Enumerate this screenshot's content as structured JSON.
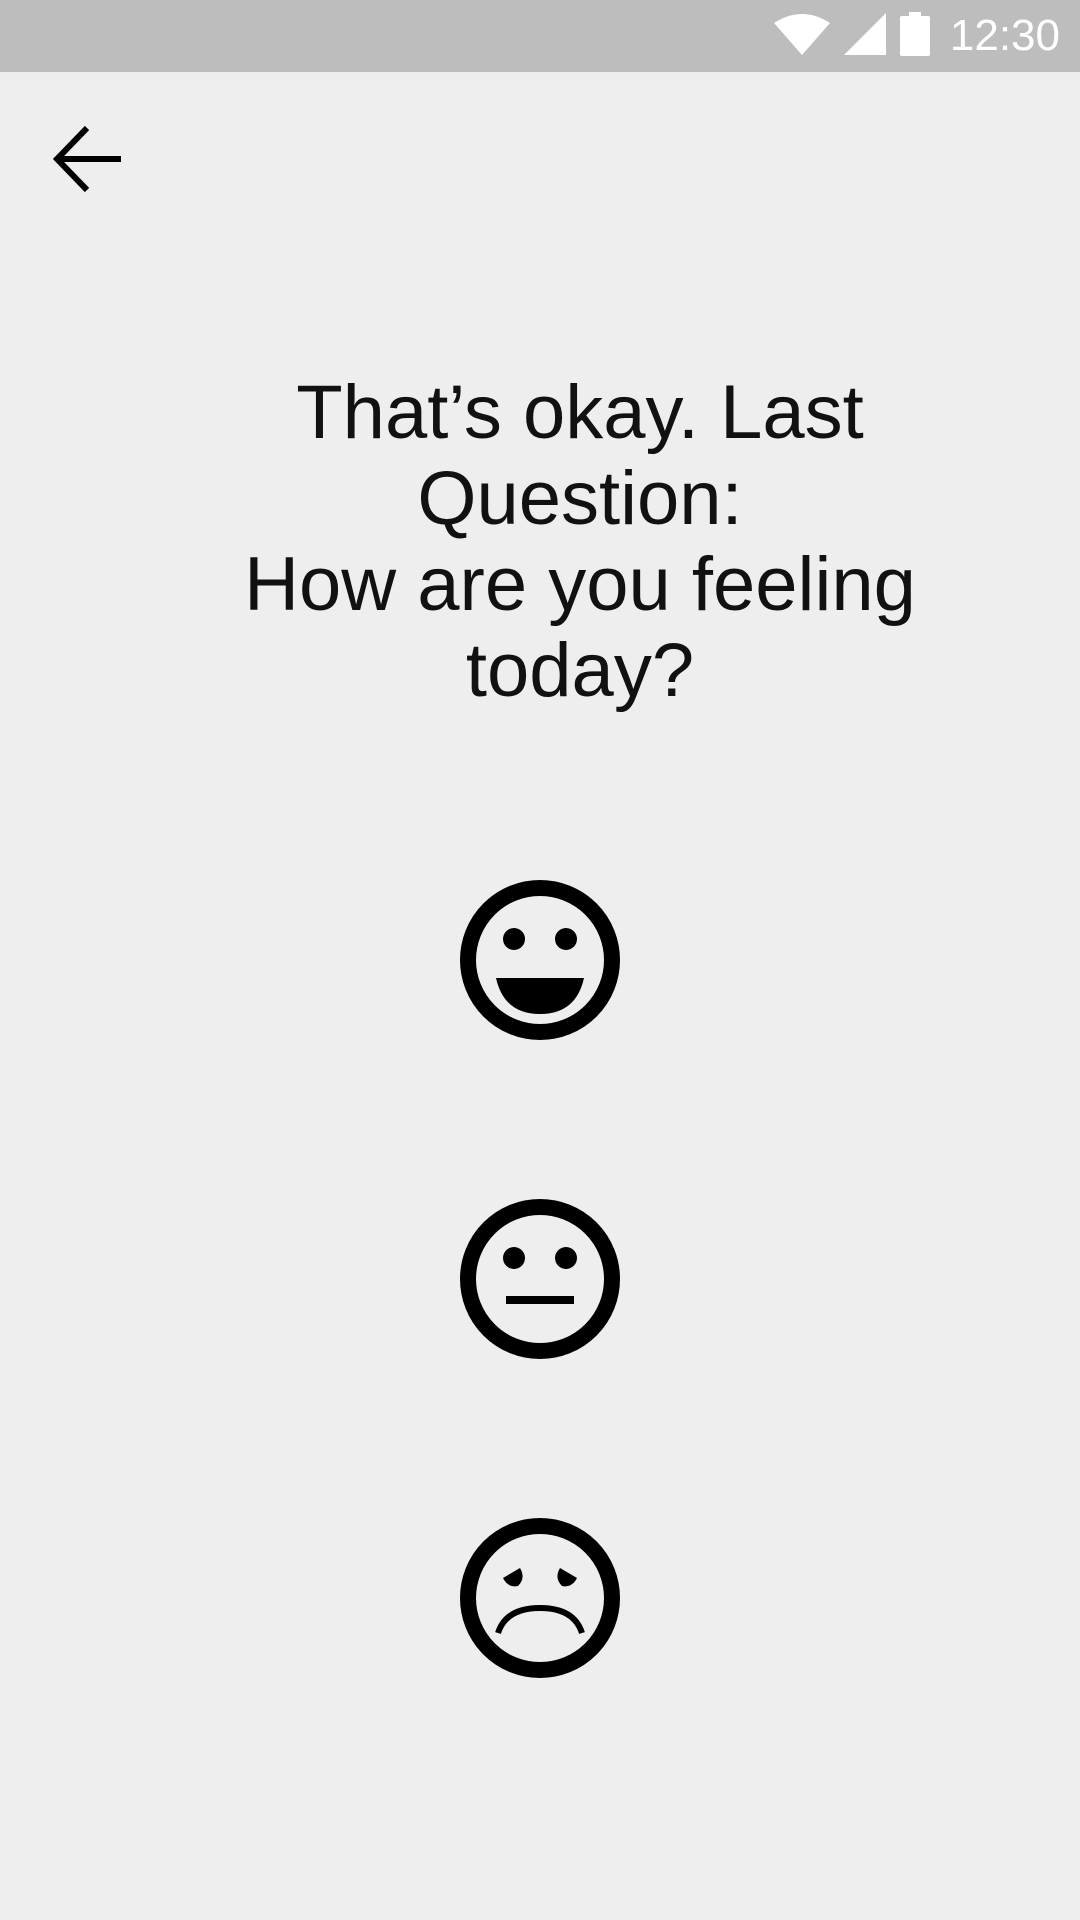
{
  "status_bar": {
    "time": "12:30",
    "icons": [
      "wifi-icon",
      "cellular-signal-icon",
      "battery-icon"
    ]
  },
  "header": {
    "back_icon": "arrow-left-icon"
  },
  "question": {
    "line1": "That’s okay. Last Question:",
    "line2": "How are you feeling today?"
  },
  "moods": [
    {
      "icon": "happy-face-icon"
    },
    {
      "icon": "neutral-face-icon"
    },
    {
      "icon": "sad-face-icon"
    }
  ],
  "colors": {
    "background": "#eeeeee",
    "status_bar": "#bdbdbd",
    "status_text": "#ffffff",
    "foreground": "#000000"
  }
}
